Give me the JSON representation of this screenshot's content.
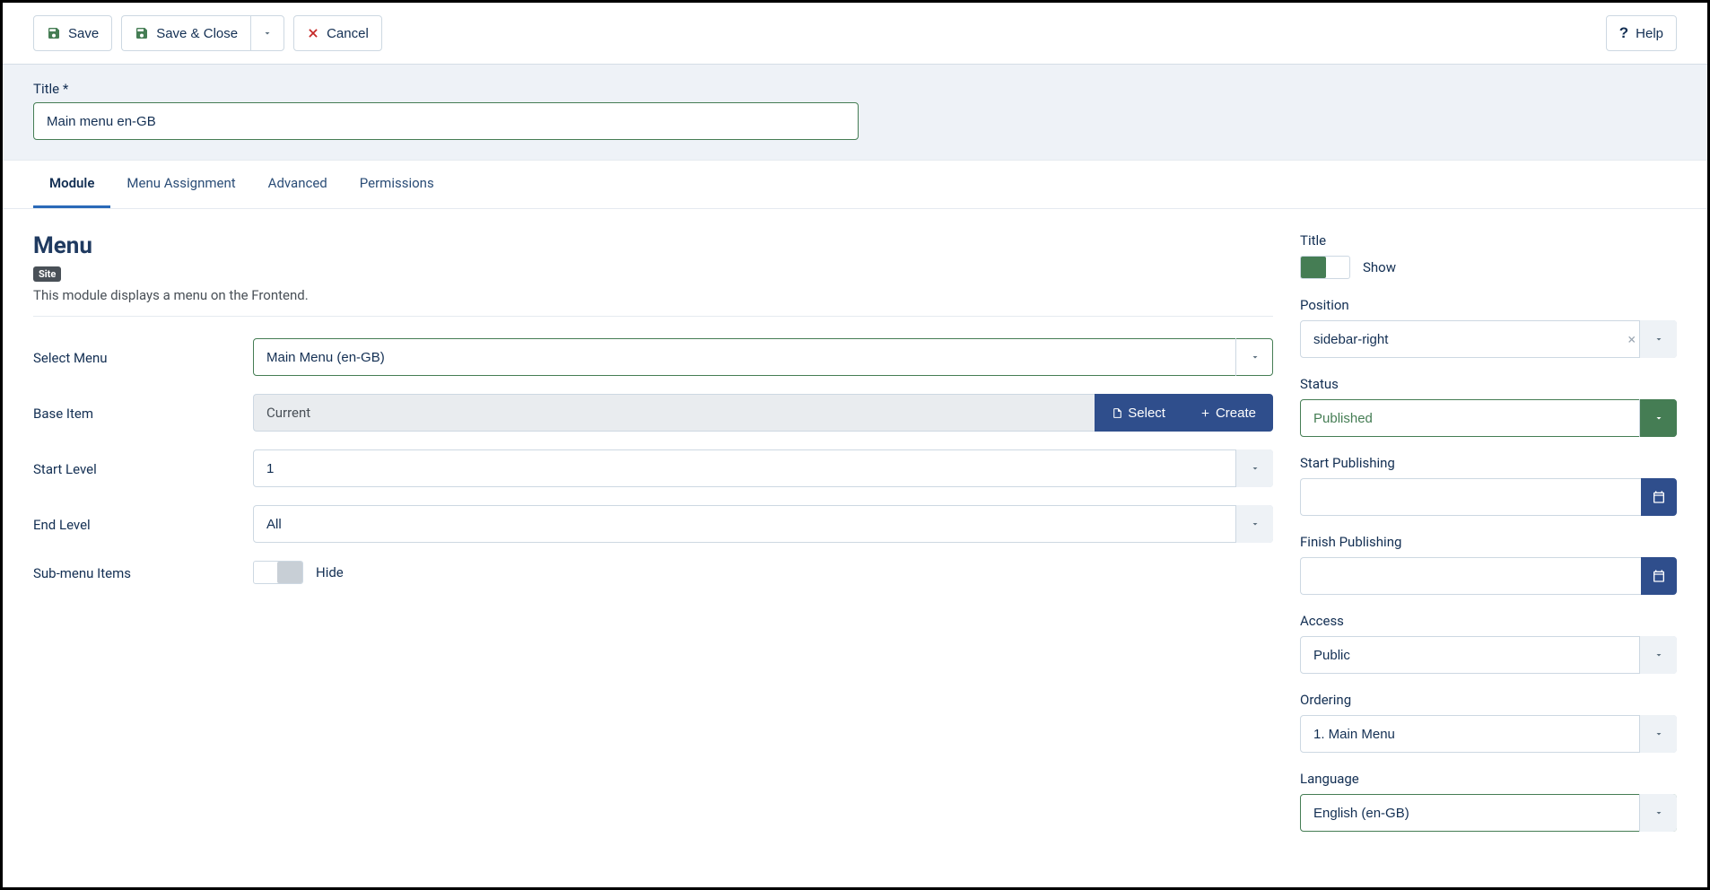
{
  "toolbar": {
    "save": "Save",
    "save_close": "Save & Close",
    "cancel": "Cancel",
    "help": "Help"
  },
  "title_field": {
    "label": "Title *",
    "value": "Main menu en-GB"
  },
  "tabs": [
    {
      "label": "Module",
      "active": true
    },
    {
      "label": "Menu Assignment",
      "active": false
    },
    {
      "label": "Advanced",
      "active": false
    },
    {
      "label": "Permissions",
      "active": false
    }
  ],
  "main": {
    "heading": "Menu",
    "badge": "Site",
    "description": "This module displays a menu on the Frontend.",
    "fields": {
      "select_menu": {
        "label": "Select Menu",
        "value": "Main Menu (en-GB)"
      },
      "base_item": {
        "label": "Base Item",
        "value": "Current",
        "select_btn": "Select",
        "create_btn": "Create"
      },
      "start_level": {
        "label": "Start Level",
        "value": "1"
      },
      "end_level": {
        "label": "End Level",
        "value": "All"
      },
      "submenu": {
        "label": "Sub-menu Items",
        "value": "Hide"
      }
    }
  },
  "side": {
    "title": {
      "label": "Title",
      "value": "Show"
    },
    "position": {
      "label": "Position",
      "value": "sidebar-right"
    },
    "status": {
      "label": "Status",
      "value": "Published"
    },
    "start_pub": {
      "label": "Start Publishing",
      "value": ""
    },
    "finish_pub": {
      "label": "Finish Publishing",
      "value": ""
    },
    "access": {
      "label": "Access",
      "value": "Public"
    },
    "ordering": {
      "label": "Ordering",
      "value": "1. Main Menu"
    },
    "language": {
      "label": "Language",
      "value": "English (en-GB)"
    }
  }
}
